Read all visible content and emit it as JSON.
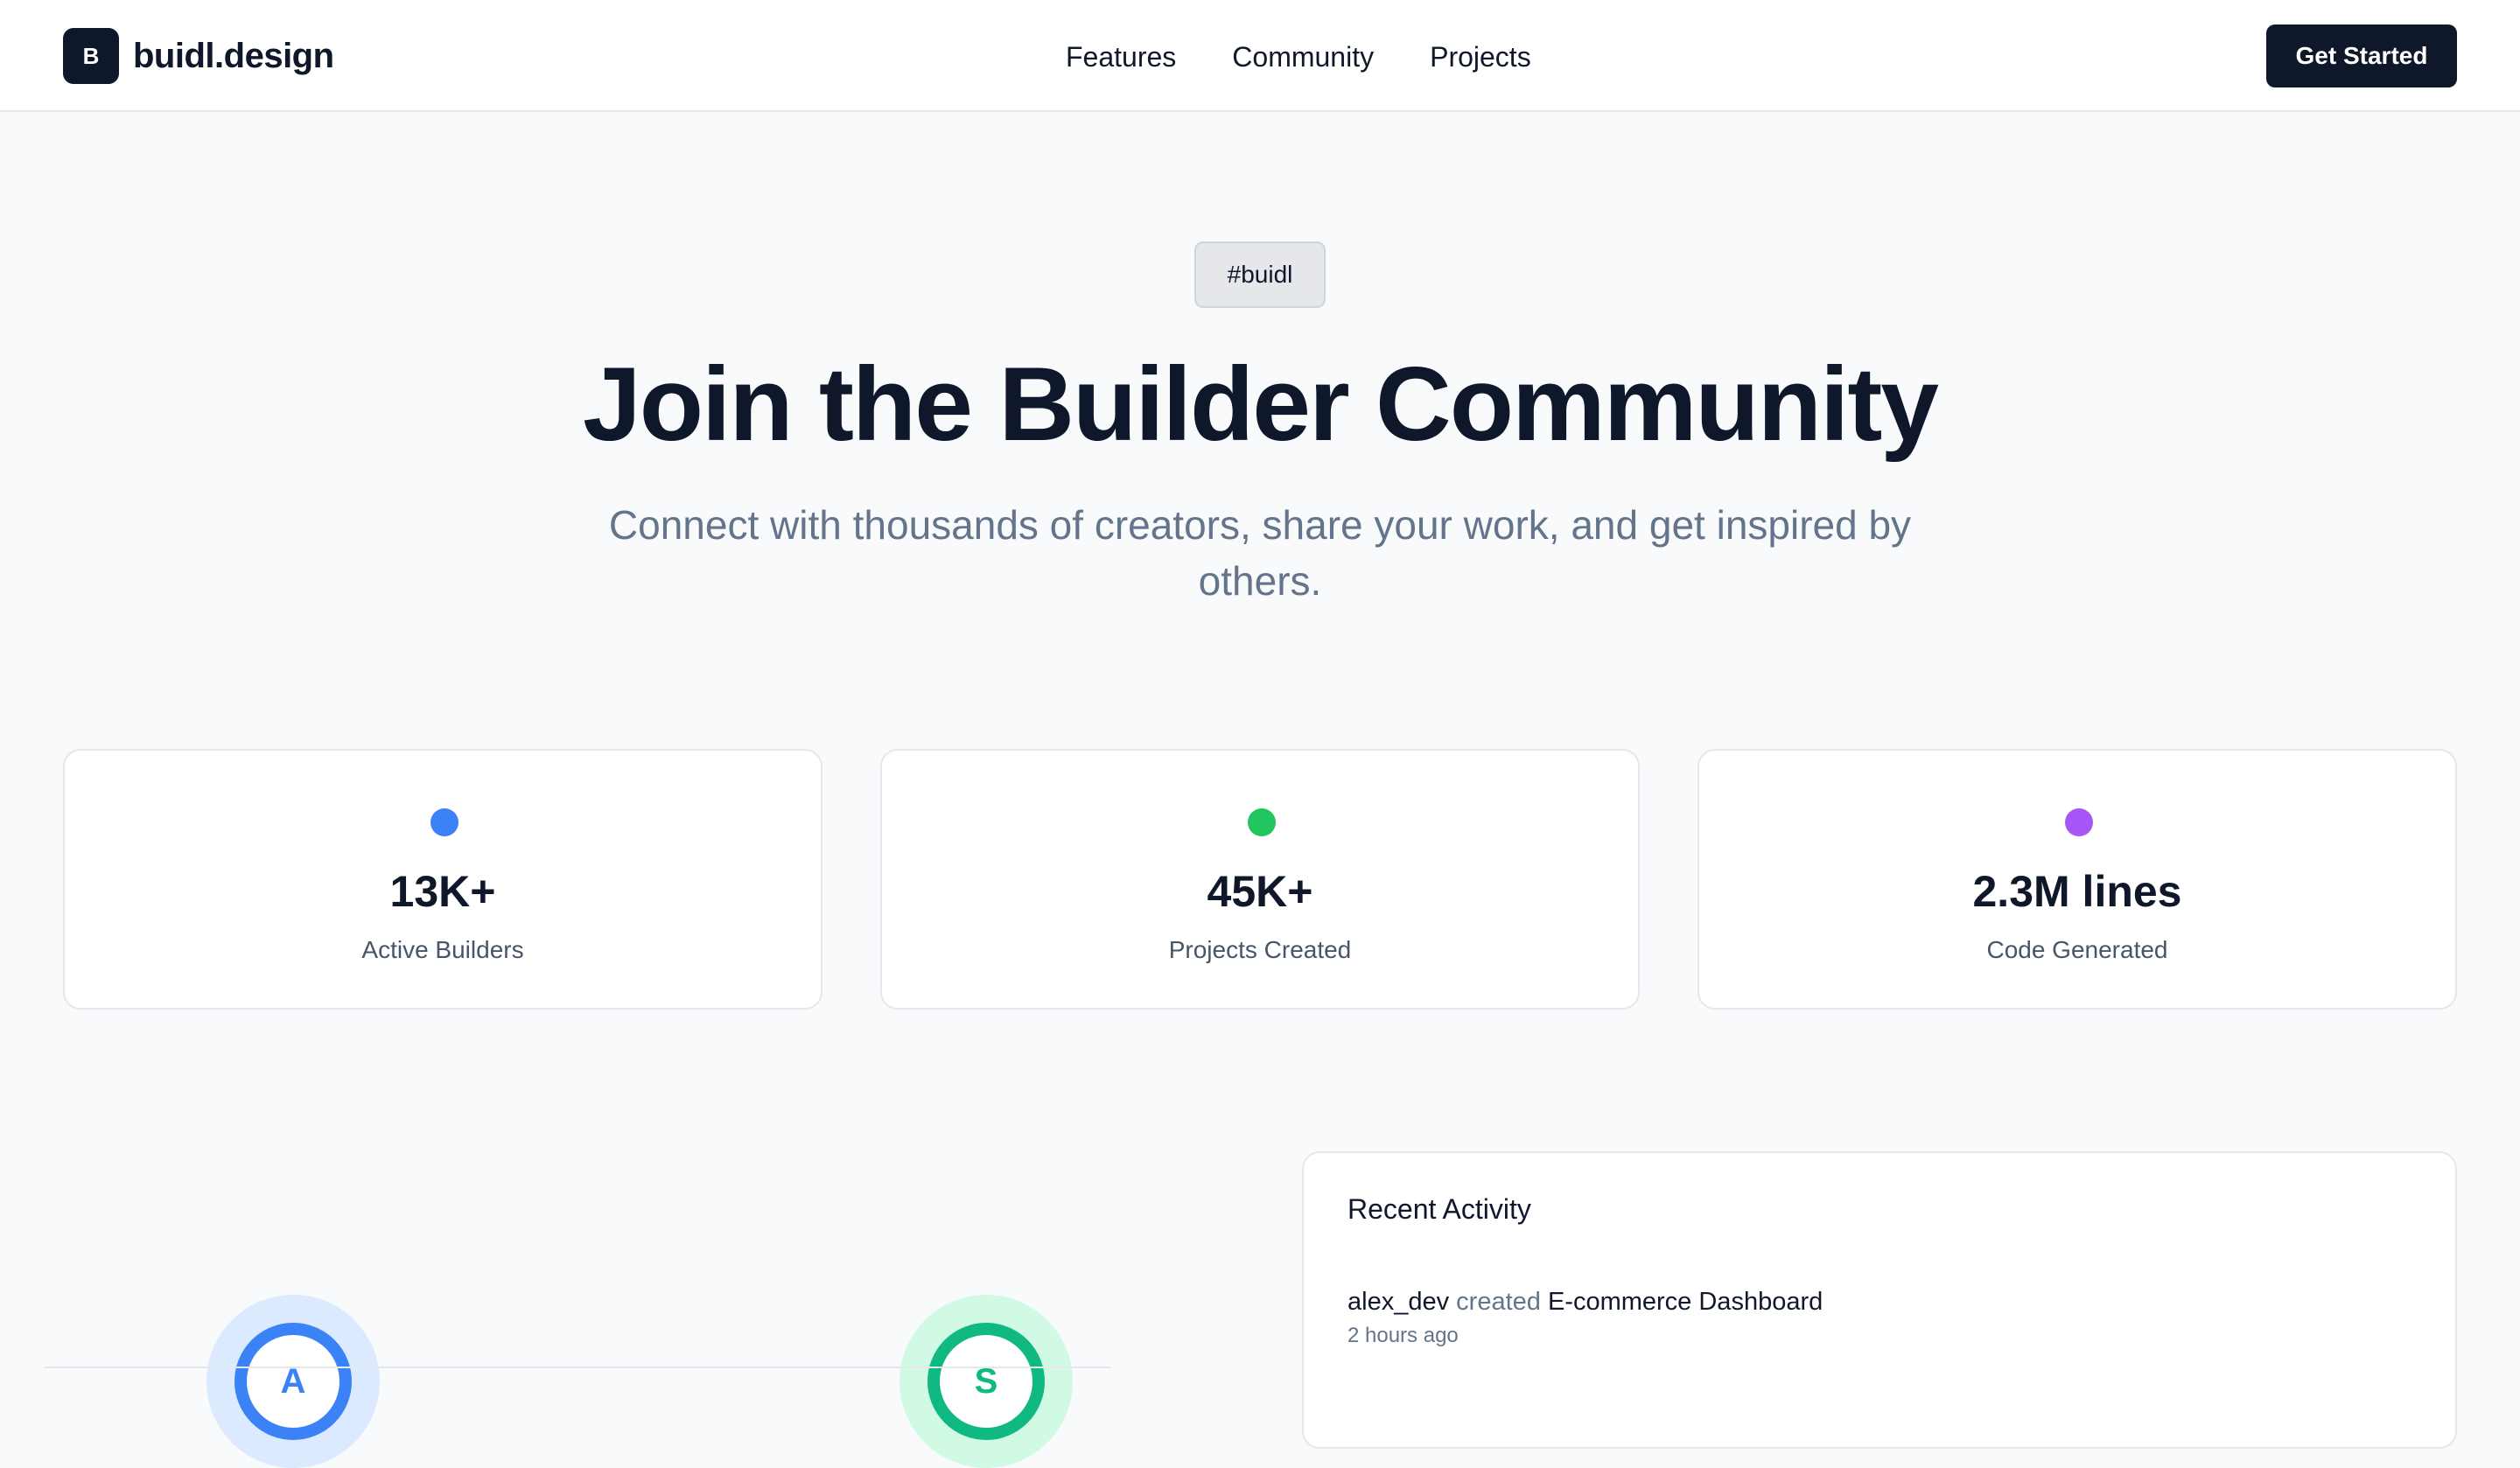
{
  "nav": {
    "logo_letter": "B",
    "brand": "buidl.design",
    "links": [
      "Features",
      "Community",
      "Projects"
    ],
    "cta": "Get Started"
  },
  "hero": {
    "tag": "#buidl",
    "title": "Join the Builder Community",
    "subtitle": "Connect with thousands of creators, share your work, and get inspired by others."
  },
  "stats": [
    {
      "value": "13K+",
      "label": "Active Builders",
      "dot_color": "#3b82f6"
    },
    {
      "value": "45K+",
      "label": "Projects Created",
      "dot_color": "#22c55e"
    },
    {
      "value": "2.3M lines",
      "label": "Code Generated",
      "dot_color": "#a855f7"
    }
  ],
  "avatars": [
    {
      "initial": "A",
      "color": "#3b82f6",
      "halo": "#dbeafe"
    },
    {
      "initial": "S",
      "color": "#10b981",
      "halo": "#d1fae5"
    }
  ],
  "activity": {
    "title": "Recent Activity",
    "items": [
      {
        "user": "alex_dev",
        "verb": "created",
        "project": "E-commerce Dashboard",
        "time": "2 hours ago"
      }
    ]
  }
}
